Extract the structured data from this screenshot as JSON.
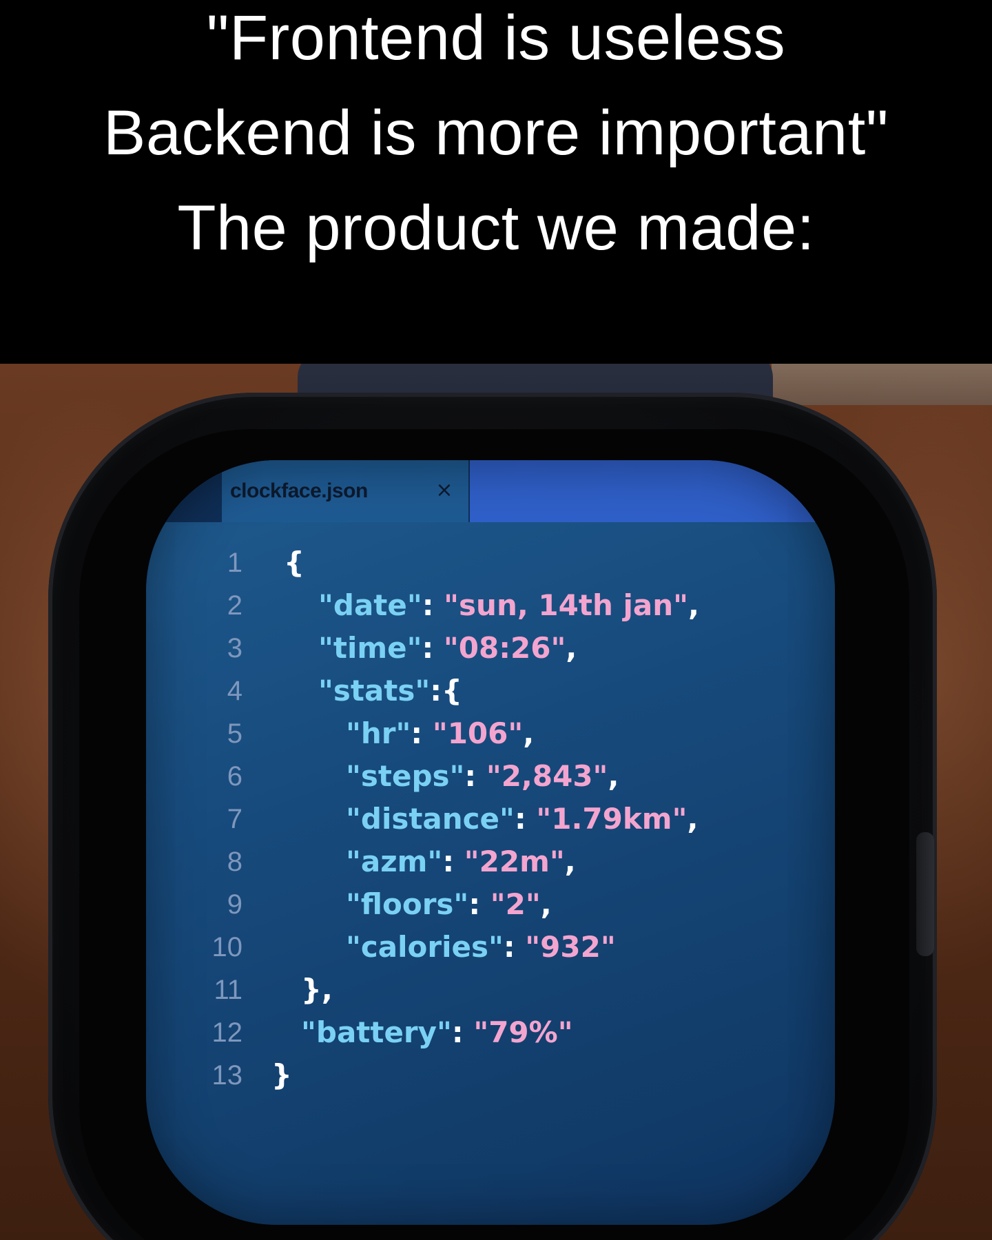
{
  "caption": {
    "line1": "\"Frontend is useless",
    "line2": "Backend is more important\"",
    "line3": "The product we made:"
  },
  "watch": {
    "tab": {
      "filename": "clockface.json",
      "close_glyph": "×"
    },
    "lines": [
      {
        "n": "1",
        "parts": [
          {
            "t": "{",
            "c": "p"
          }
        ]
      },
      {
        "n": "2",
        "parts": [
          {
            "t": "\"date\"",
            "c": "k"
          },
          {
            "t": ": ",
            "c": "p"
          },
          {
            "t": "\"sun, 14th jan\"",
            "c": "v"
          },
          {
            "t": ",",
            "c": "p"
          }
        ]
      },
      {
        "n": "3",
        "parts": [
          {
            "t": "\"time\"",
            "c": "k"
          },
          {
            "t": ": ",
            "c": "p"
          },
          {
            "t": "\"08:26\"",
            "c": "v"
          },
          {
            "t": ",",
            "c": "p"
          }
        ]
      },
      {
        "n": "4",
        "parts": [
          {
            "t": "\"stats\"",
            "c": "k"
          },
          {
            "t": ":{",
            "c": "p"
          }
        ]
      },
      {
        "n": "5",
        "parts": [
          {
            "t": "\"hr\"",
            "c": "k"
          },
          {
            "t": ": ",
            "c": "p"
          },
          {
            "t": "\"106\"",
            "c": "v"
          },
          {
            "t": ",",
            "c": "p"
          }
        ]
      },
      {
        "n": "6",
        "parts": [
          {
            "t": "\"steps\"",
            "c": "k"
          },
          {
            "t": ": ",
            "c": "p"
          },
          {
            "t": "\"2,843\"",
            "c": "v"
          },
          {
            "t": ",",
            "c": "p"
          }
        ]
      },
      {
        "n": "7",
        "parts": [
          {
            "t": "\"distance\"",
            "c": "k"
          },
          {
            "t": ": ",
            "c": "p"
          },
          {
            "t": "\"1.79km\"",
            "c": "v"
          },
          {
            "t": ",",
            "c": "p"
          }
        ]
      },
      {
        "n": "8",
        "parts": [
          {
            "t": "\"azm\"",
            "c": "k"
          },
          {
            "t": ": ",
            "c": "p"
          },
          {
            "t": "\"22m\"",
            "c": "v"
          },
          {
            "t": ",",
            "c": "p"
          }
        ]
      },
      {
        "n": "9",
        "parts": [
          {
            "t": "\"floors\"",
            "c": "k"
          },
          {
            "t": ": ",
            "c": "p"
          },
          {
            "t": "\"2\"",
            "c": "v"
          },
          {
            "t": ",",
            "c": "p"
          }
        ]
      },
      {
        "n": "10",
        "parts": [
          {
            "t": "\"calories\"",
            "c": "k"
          },
          {
            "t": ": ",
            "c": "p"
          },
          {
            "t": "\"932\"",
            "c": "v"
          }
        ]
      },
      {
        "n": "11",
        "parts": [
          {
            "t": "},",
            "c": "p"
          }
        ]
      },
      {
        "n": "12",
        "parts": [
          {
            "t": "\"battery\"",
            "c": "k"
          },
          {
            "t": ": ",
            "c": "p"
          },
          {
            "t": "\"79%\"",
            "c": "v"
          }
        ]
      },
      {
        "n": "13",
        "parts": [
          {
            "t": "}",
            "c": "p"
          }
        ]
      }
    ]
  },
  "colors": {
    "screen_bg": "#174a7c",
    "json_key": "#7ad1f4",
    "json_value": "#f3a5cf",
    "line_number": "#7f97bd"
  }
}
